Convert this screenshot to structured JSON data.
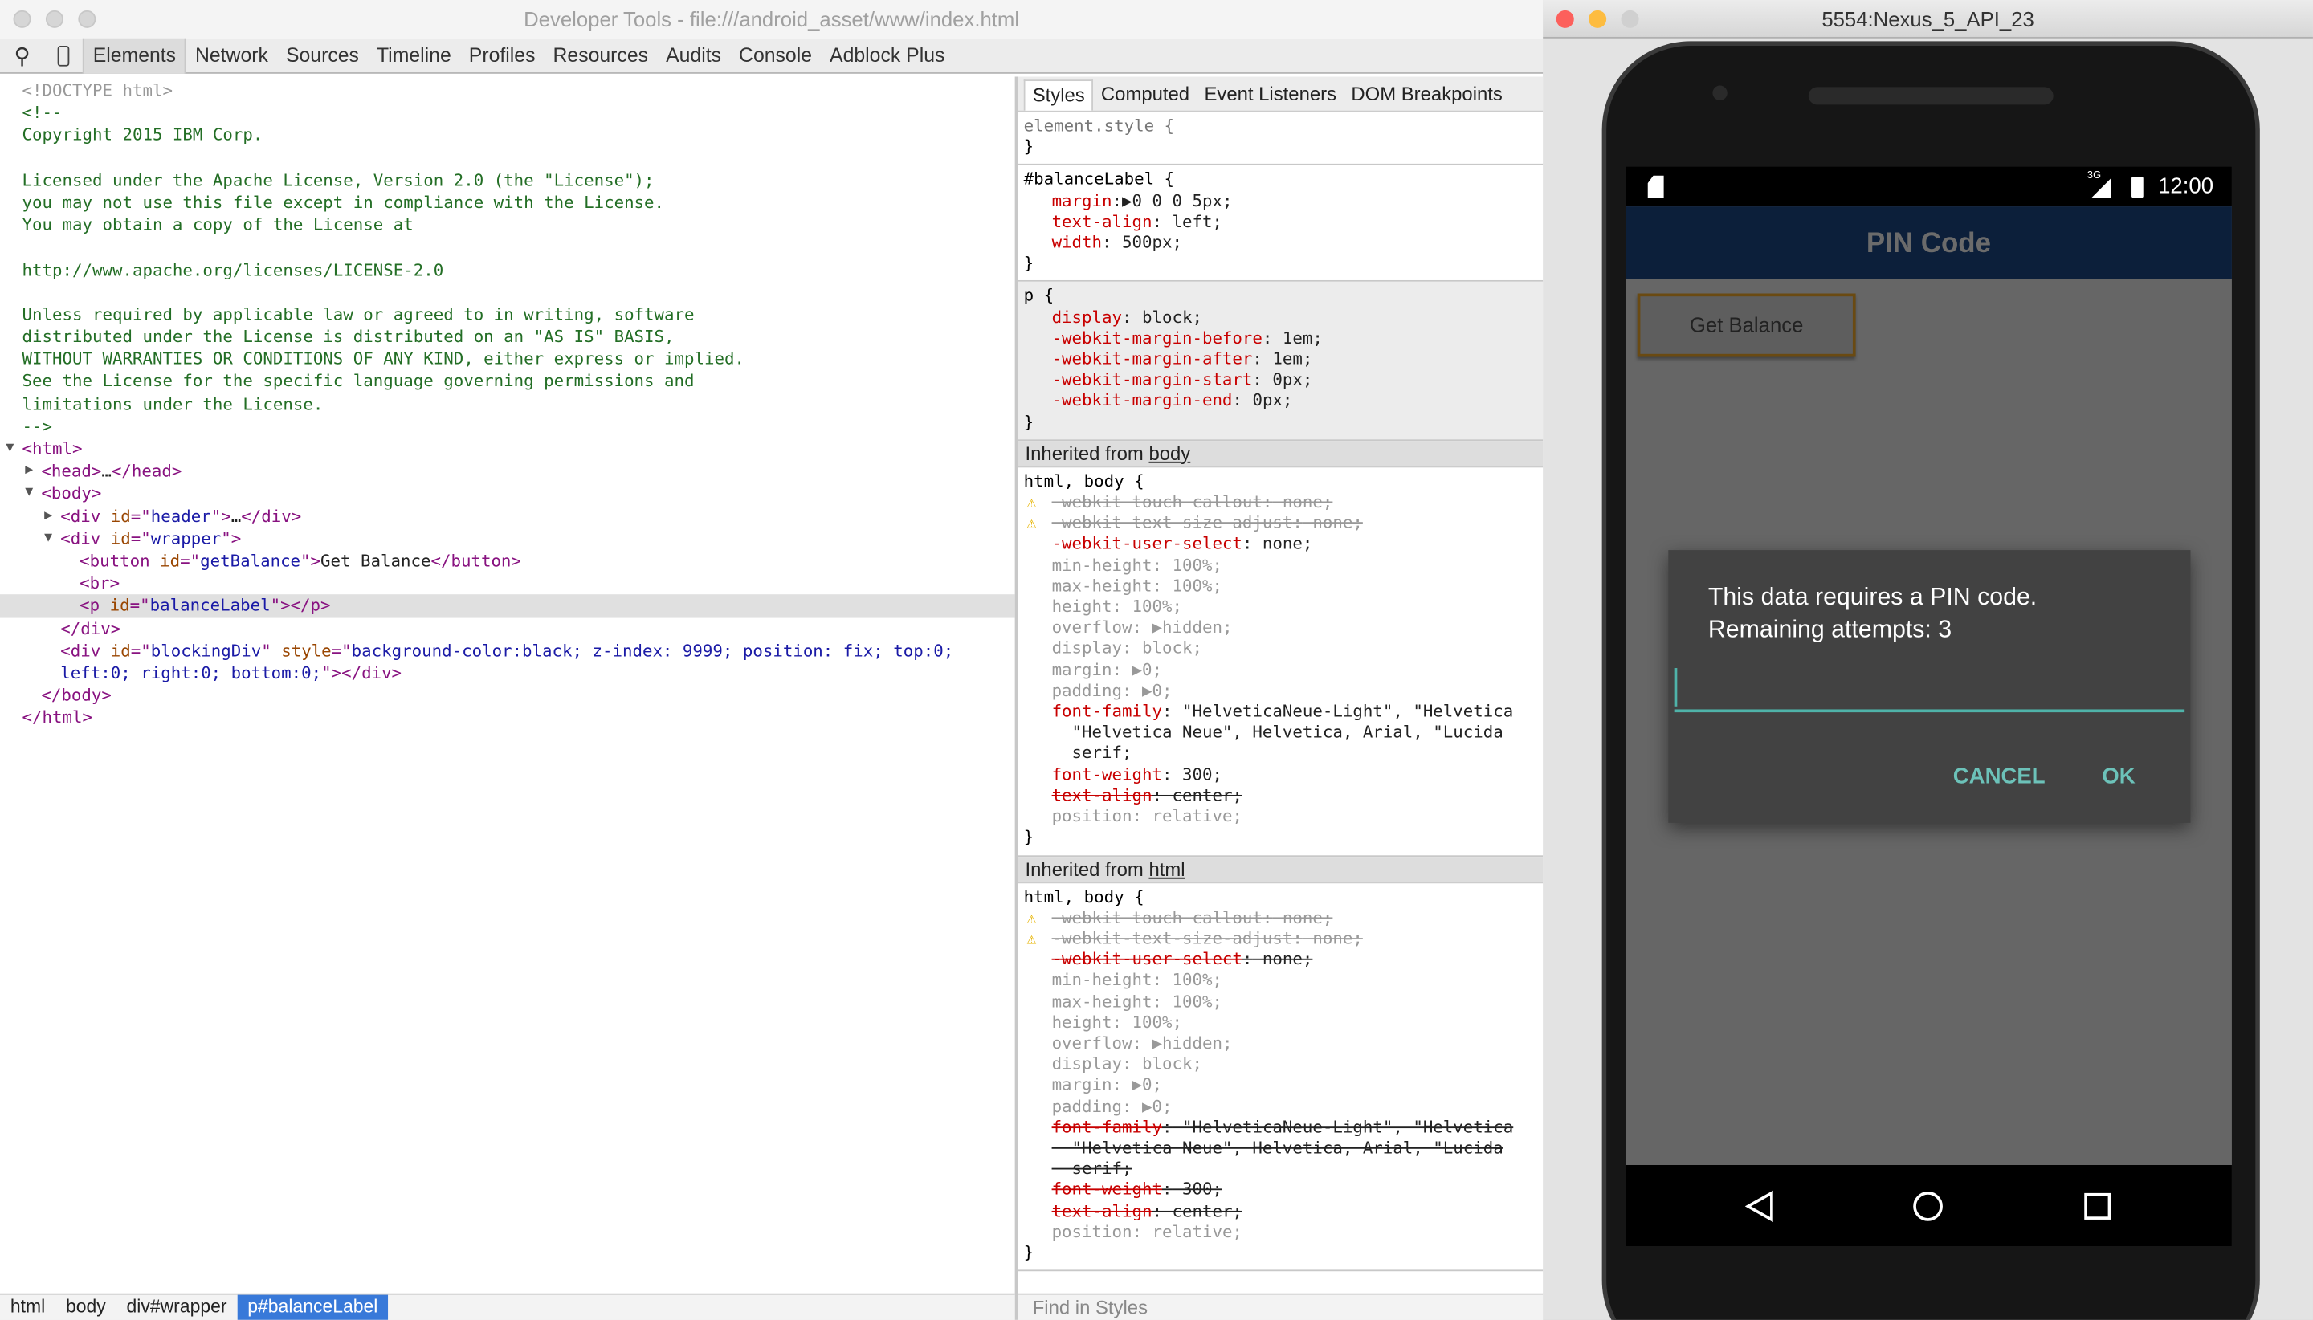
{
  "devtools": {
    "title": "Developer Tools - file:///android_asset/www/index.html",
    "tabs": [
      "Elements",
      "Network",
      "Sources",
      "Timeline",
      "Profiles",
      "Resources",
      "Audits",
      "Console",
      "Adblock Plus"
    ],
    "active_tab": "Elements",
    "dom_lines": [
      {
        "i": 0,
        "p": [
          [
            "<!DOCTYPE html>",
            "gray"
          ]
        ]
      },
      {
        "i": 0,
        "p": [
          [
            "<!--",
            "cm"
          ]
        ]
      },
      {
        "i": 0,
        "p": [
          [
            "Copyright 2015 IBM Corp.",
            "cm"
          ]
        ]
      },
      {
        "i": 0,
        "p": [
          [
            "",
            "cm"
          ]
        ]
      },
      {
        "i": 0,
        "p": [
          [
            "Licensed under the Apache License, Version 2.0 (the \"License\");",
            "cm"
          ]
        ]
      },
      {
        "i": 0,
        "p": [
          [
            "you may not use this file except in compliance with the License.",
            "cm"
          ]
        ]
      },
      {
        "i": 0,
        "p": [
          [
            "You may obtain a copy of the License at",
            "cm"
          ]
        ]
      },
      {
        "i": 0,
        "p": [
          [
            "",
            "cm"
          ]
        ]
      },
      {
        "i": 0,
        "p": [
          [
            "http://www.apache.org/licenses/LICENSE-2.0",
            "cm"
          ]
        ]
      },
      {
        "i": 0,
        "p": [
          [
            "",
            "cm"
          ]
        ]
      },
      {
        "i": 0,
        "p": [
          [
            "Unless required by applicable law or agreed to in writing, software",
            "cm"
          ]
        ]
      },
      {
        "i": 0,
        "p": [
          [
            "distributed under the License is distributed on an \"AS IS\" BASIS,",
            "cm"
          ]
        ]
      },
      {
        "i": 0,
        "p": [
          [
            "WITHOUT WARRANTIES OR CONDITIONS OF ANY KIND, either express or implied.",
            "cm"
          ]
        ]
      },
      {
        "i": 0,
        "p": [
          [
            "See the License for the specific language governing permissions and",
            "cm"
          ]
        ]
      },
      {
        "i": 0,
        "p": [
          [
            "limitations under the License.",
            "cm"
          ]
        ]
      },
      {
        "i": 0,
        "p": [
          [
            "-->",
            "cm"
          ]
        ]
      },
      {
        "i": 0,
        "a": "down",
        "p": [
          [
            "<html>",
            "tag"
          ]
        ]
      },
      {
        "i": 1,
        "a": "right",
        "p": [
          [
            "<head>",
            "tag"
          ],
          [
            "…",
            "tx"
          ],
          [
            "</head>",
            "tag"
          ]
        ]
      },
      {
        "i": 1,
        "a": "down",
        "p": [
          [
            "<body>",
            "tag"
          ]
        ]
      },
      {
        "i": 2,
        "a": "right",
        "p": [
          [
            "<div ",
            "tag"
          ],
          [
            "id",
            "an"
          ],
          [
            "=\"",
            "tag"
          ],
          [
            "header",
            "av"
          ],
          [
            "\">",
            "tag"
          ],
          [
            "…",
            "tx"
          ],
          [
            "</div>",
            "tag"
          ]
        ]
      },
      {
        "i": 2,
        "a": "down",
        "p": [
          [
            "<div ",
            "tag"
          ],
          [
            "id",
            "an"
          ],
          [
            "=\"",
            "tag"
          ],
          [
            "wrapper",
            "av"
          ],
          [
            "\">",
            "tag"
          ]
        ]
      },
      {
        "i": 3,
        "p": [
          [
            "<button ",
            "tag"
          ],
          [
            "id",
            "an"
          ],
          [
            "=\"",
            "tag"
          ],
          [
            "getBalance",
            "av"
          ],
          [
            "\">",
            "tag"
          ],
          [
            "Get Balance",
            "tx"
          ],
          [
            "</button>",
            "tag"
          ]
        ]
      },
      {
        "i": 3,
        "p": [
          [
            "<br>",
            "tag"
          ]
        ]
      },
      {
        "i": 3,
        "sel": true,
        "p": [
          [
            "<p ",
            "tag"
          ],
          [
            "id",
            "an"
          ],
          [
            "=\"",
            "tag"
          ],
          [
            "balanceLabel",
            "av"
          ],
          [
            "\"></p>",
            "tag"
          ]
        ]
      },
      {
        "i": 2,
        "p": [
          [
            "</div>",
            "tag"
          ]
        ]
      },
      {
        "i": 2,
        "p": [
          [
            "<div ",
            "tag"
          ],
          [
            "id",
            "an"
          ],
          [
            "=\"",
            "tag"
          ],
          [
            "blockingDiv",
            "av"
          ],
          [
            "\" ",
            "tag"
          ],
          [
            "style",
            "an"
          ],
          [
            "=\"",
            "tag"
          ],
          [
            "background-color:black; z-index: 9999; position: fix; top:0;",
            "av"
          ]
        ]
      },
      {
        "i": 2,
        "p": [
          [
            "left:0; right:0; bottom:0;",
            "av"
          ],
          [
            "\"></div>",
            "tag"
          ]
        ]
      },
      {
        "i": 1,
        "p": [
          [
            "</body>",
            "tag"
          ]
        ]
      },
      {
        "i": 0,
        "p": [
          [
            "</html>",
            "tag"
          ]
        ]
      }
    ],
    "breadcrumbs": [
      "html",
      "body",
      "div#wrapper",
      "p#balanceLabel"
    ],
    "styles": {
      "tabs": [
        "Styles",
        "Computed",
        "Event Listeners",
        "DOM Breakpoints"
      ],
      "active_tab": "Styles",
      "blocks": [
        {
          "selector": "element.style {",
          "sel_gray": true,
          "props": []
        },
        {
          "selector": "#balanceLabel {",
          "props": [
            {
              "n": "margin",
              "v": "▶0 0 0 5px;"
            },
            {
              "n": "text-align",
              "v": " left;"
            },
            {
              "n": "width",
              "v": " 500px;"
            }
          ]
        },
        {
          "selector": "p {",
          "ua": true,
          "props": [
            {
              "n": "display",
              "v": " block;"
            },
            {
              "n": "-webkit-margin-before",
              "v": " 1em;"
            },
            {
              "n": "-webkit-margin-after",
              "v": " 1em;"
            },
            {
              "n": "-webkit-margin-start",
              "v": " 0px;"
            },
            {
              "n": "-webkit-margin-end",
              "v": " 0px;"
            }
          ]
        },
        {
          "header": "Inherited from ",
          "header_link": "body",
          "selector": "html, body {",
          "props": [
            {
              "n": "-webkit-touch-callout",
              "v": " none;",
              "s": true,
              "w": true,
              "x": true
            },
            {
              "n": "-webkit-text-size-adjust",
              "v": " none;",
              "s": true,
              "w": true,
              "x": true
            },
            {
              "n": "-webkit-user-select",
              "v": " none;"
            },
            {
              "n": "min-height",
              "v": " 100%;",
              "x": true
            },
            {
              "n": "max-height",
              "v": " 100%;",
              "x": true
            },
            {
              "n": "height",
              "v": " 100%;",
              "x": true
            },
            {
              "n": "overflow",
              "v": " ▶hidden;",
              "x": true
            },
            {
              "n": "display",
              "v": " block;",
              "x": true
            },
            {
              "n": "margin",
              "v": " ▶0;",
              "x": true
            },
            {
              "n": "padding",
              "v": " ▶0;",
              "x": true
            },
            {
              "n": "font-family",
              "v": " \"HelveticaNeue-Light\", \"Helvetica"
            },
            {
              "n": "",
              "v": "  \"Helvetica Neue\", Helvetica, Arial, \"Lucida"
            },
            {
              "n": "",
              "v": "  serif;"
            },
            {
              "n": "font-weight",
              "v": " 300;"
            },
            {
              "n": "text-align",
              "v": " center;",
              "s": true
            },
            {
              "n": "position",
              "v": " relative;",
              "x": true
            }
          ]
        },
        {
          "header": "Inherited from ",
          "header_link": "html",
          "selector": "html, body {",
          "props": [
            {
              "n": "-webkit-touch-callout",
              "v": " none;",
              "s": true,
              "w": true,
              "x": true
            },
            {
              "n": "-webkit-text-size-adjust",
              "v": " none;",
              "s": true,
              "w": true,
              "x": true
            },
            {
              "n": "-webkit-user-select",
              "v": " none;",
              "s": true
            },
            {
              "n": "min-height",
              "v": " 100%;",
              "x": true
            },
            {
              "n": "max-height",
              "v": " 100%;",
              "x": true
            },
            {
              "n": "height",
              "v": " 100%;",
              "x": true
            },
            {
              "n": "overflow",
              "v": " ▶hidden;",
              "x": true
            },
            {
              "n": "display",
              "v": " block;",
              "x": true
            },
            {
              "n": "margin",
              "v": " ▶0;",
              "x": true
            },
            {
              "n": "padding",
              "v": " ▶0;",
              "x": true
            },
            {
              "n": "font-family",
              "v": " \"HelveticaNeue-Light\", \"Helvetica",
              "s": true
            },
            {
              "n": "",
              "v": "  \"Helvetica Neue\", Helvetica, Arial, \"Lucida",
              "s": true
            },
            {
              "n": "",
              "v": "  serif;",
              "s": true
            },
            {
              "n": "font-weight",
              "v": " 300;",
              "s": true
            },
            {
              "n": "text-align",
              "v": " center;",
              "s": true
            },
            {
              "n": "position",
              "v": " relative;",
              "x": true
            }
          ]
        }
      ],
      "find_placeholder": "Find in Styles"
    }
  },
  "emulator": {
    "title": "5554:Nexus_5_API_23",
    "status": {
      "network": "3G",
      "time": "12:00"
    },
    "app_title": "PIN Code",
    "button": "Get Balance",
    "dialog": {
      "line1": "This data requires a PIN code.",
      "line2": "Remaining attempts: 3",
      "input_value": "",
      "cancel": "CANCEL",
      "ok": "OK"
    },
    "colors": {
      "appbar": "#0c1f3a",
      "accent": "#4fb3a9"
    }
  }
}
